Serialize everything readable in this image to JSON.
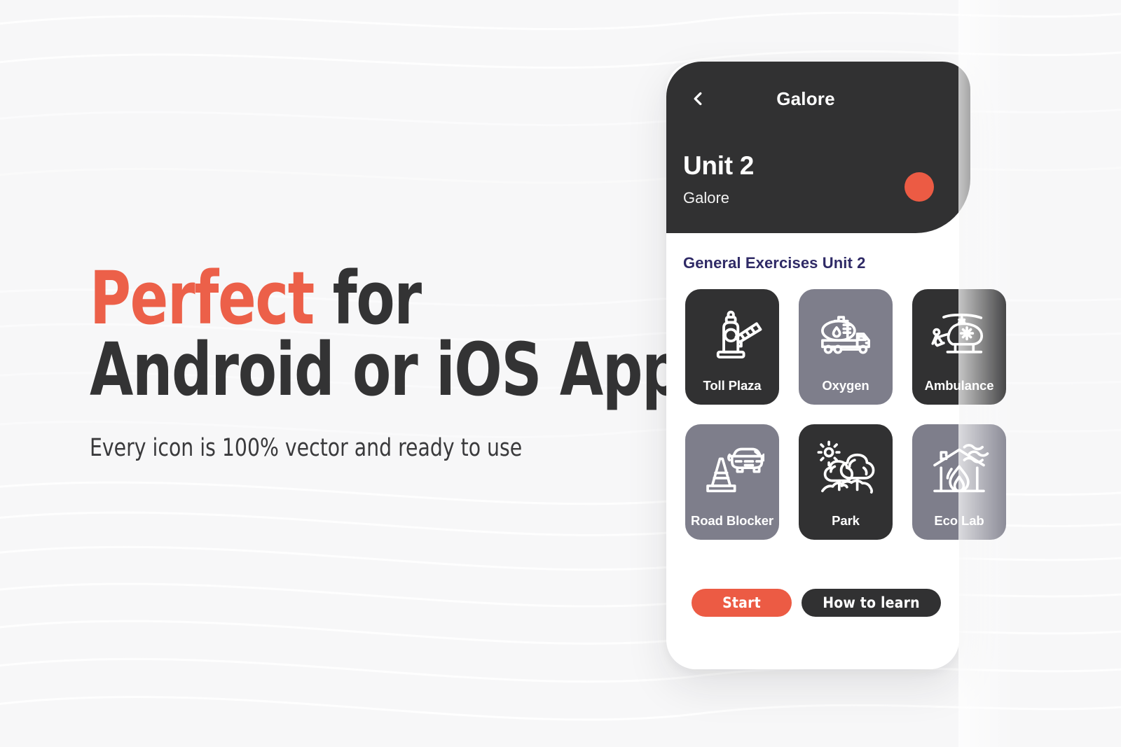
{
  "hero": {
    "headline_line1_accent": "Perfect",
    "headline_line1_rest": " for",
    "headline_line2": "Android or iOS Apps",
    "subhead": "Every icon is 100% vector and ready to use"
  },
  "colors": {
    "accent": "#ec5b44",
    "dark": "#313132",
    "gray_tile": "#7e7e8b",
    "section_title": "#2f2a66",
    "page_background": "#f7f7f8",
    "card_background": "#ffffff"
  },
  "app": {
    "back_icon": "chevron-left-icon",
    "title": "Galore",
    "unit_title": "Unit 2",
    "unit_subtitle": "Galore",
    "status_dot": "status-dot",
    "section_title": "General Exercises Unit 2",
    "tiles": [
      {
        "label": "Toll Plaza",
        "icon": "toll-barrier-icon",
        "theme": "dark"
      },
      {
        "label": "Oxygen",
        "icon": "tanker-truck-icon",
        "theme": "gray"
      },
      {
        "label": "Ambulance",
        "icon": "helicopter-icon",
        "theme": "dark"
      },
      {
        "label": "Road Blocker",
        "icon": "traffic-cone-car-icon",
        "theme": "gray"
      },
      {
        "label": "Park",
        "icon": "trees-sun-icon",
        "theme": "dark"
      },
      {
        "label": "Eco Lab",
        "icon": "burning-house-icon",
        "theme": "gray"
      }
    ],
    "buttons": {
      "start": "Start",
      "how_to_learn": "How to learn"
    }
  }
}
